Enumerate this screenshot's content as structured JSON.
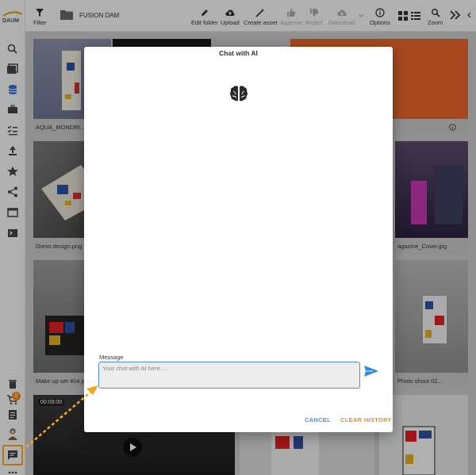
{
  "sidebar": {
    "logo_text": "DAUM",
    "cart_count": "0",
    "icons": [
      "search-icon",
      "gallery-icon",
      "database-icon",
      "briefcase-icon",
      "checklist-icon",
      "upload-icon",
      "star-icon",
      "share-icon",
      "window-icon",
      "terminal-icon",
      "trash-icon",
      "cart-icon",
      "document-icon",
      "user-avatar",
      "chat-icon",
      "more-icon"
    ]
  },
  "toolbar": {
    "filter_label": "Filter",
    "folder_name": "FUSION DAM",
    "edit_folder": "Edit folder",
    "upload": "Upload",
    "create_asset": "Create asset",
    "approve": "Approve",
    "reject": "Reject",
    "download": "Download",
    "options": "Options",
    "zoom": "Zoom"
  },
  "assets": [
    {
      "name": "AQUA_MONDRI..."
    },
    {
      "name": "Dress design.png"
    },
    {
      "name": "Make up set 404.p"
    },
    {
      "name": "agazine_Cover.jpg"
    },
    {
      "name": "Photo shoot 02..."
    },
    {
      "name": "00:09:00"
    }
  ],
  "dialog": {
    "title": "Chat with AI",
    "message_label": "Message",
    "message_placeholder": "Your chat with AI here....",
    "cancel": "CANCEL",
    "clear_history": "CLEAR HISTORY"
  },
  "colors": {
    "accent_blue": "#4a90e2",
    "accent_orange": "#f08a1c",
    "annotation": "#f5a623"
  }
}
